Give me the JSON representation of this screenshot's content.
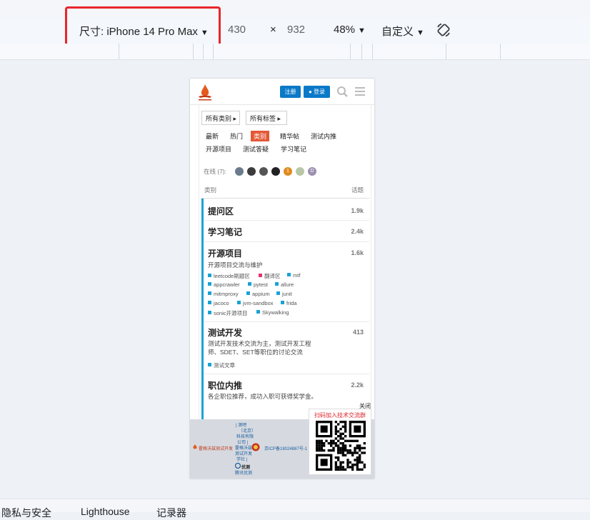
{
  "toolbar": {
    "device_label": "尺寸: iPhone 14 Pro Max",
    "width": "430",
    "times": "×",
    "height": "932",
    "zoom": "48%",
    "throttle": "自定义"
  },
  "bottom_tabs": [
    "隐私与安全",
    "Lighthouse",
    "记录器"
  ],
  "site": {
    "register_label": "注册",
    "login_label": "登录",
    "filters": {
      "categories": "所有类别",
      "tags": "所有标签"
    },
    "nav_tabs": [
      "最新",
      "热门",
      "类别",
      "精华帖",
      "测试内推",
      "开源项目",
      "测试答疑",
      "学习笔记"
    ],
    "active_tab": "类别",
    "online_label": "在线 (7):",
    "avatars": [
      {
        "label": "",
        "color": "#6b7b8c"
      },
      {
        "label": "",
        "color": "#3c3c3c"
      },
      {
        "label": "",
        "color": "#555555"
      },
      {
        "label": "",
        "color": "#222222"
      },
      {
        "label": "1",
        "color": "#e08a1e"
      },
      {
        "label": "",
        "color": "#b8c7a8"
      },
      {
        "label": "D",
        "color": "#9c8fb0"
      }
    ],
    "table_header": {
      "category": "类别",
      "topics": "话题"
    },
    "categories": [
      {
        "title": "提问区",
        "count": "1.9k"
      },
      {
        "title": "学习笔记",
        "count": "2.4k"
      },
      {
        "title": "开源项目",
        "count": "1.6k",
        "desc": "开源项目交流与维护",
        "subs": [
          {
            "name": "leetcode刷题区",
            "color": "#1aa3d4"
          },
          {
            "name": "翻译区",
            "color": "#e8346b"
          },
          {
            "name": "mtf",
            "color": "#1aa3d4"
          },
          {
            "name": "appcrawler",
            "color": "#1aa3d4"
          },
          {
            "name": "pytest",
            "color": "#1aa3d4"
          },
          {
            "name": "allure",
            "color": "#1aa3d4"
          },
          {
            "name": "mitmproxy",
            "color": "#1aa3d4"
          },
          {
            "name": "appium",
            "color": "#1aa3d4"
          },
          {
            "name": "junit",
            "color": "#1aa3d4"
          },
          {
            "name": "jacoco",
            "color": "#1aa3d4"
          },
          {
            "name": "jvm-sandbox",
            "color": "#1aa3d4"
          },
          {
            "name": "frida",
            "color": "#1aa3d4"
          },
          {
            "name": "sonic开源项目",
            "color": "#1aa3d4"
          },
          {
            "name": "Skywalking",
            "color": "#1aa3d4"
          }
        ]
      },
      {
        "title": "测试开发",
        "count": "413",
        "desc": "测试开发技术交流为主，测试开发工程师、SDET、SET等职位的讨论交流",
        "subs": [
          {
            "name": "测试文章",
            "color": "#1aa3d4"
          }
        ]
      },
      {
        "title": "职位内推",
        "count": "2.2k",
        "desc": "各企职位推荐，成功入职可获得奖学金。"
      }
    ],
    "footer": {
      "lines": [
        "| 测吧",
        "（北京）",
        "科技有限",
        "公司 |",
        "霍格沃兹",
        "测试开发",
        "学社 |"
      ],
      "brand": "霍格沃兹测试开发",
      "icp": "京ICP备18024887号-1",
      "extra1": "优测",
      "extra2": "腾讯优测"
    },
    "close_label": "关闭",
    "qr_title": "扫码加入技术交流群"
  }
}
